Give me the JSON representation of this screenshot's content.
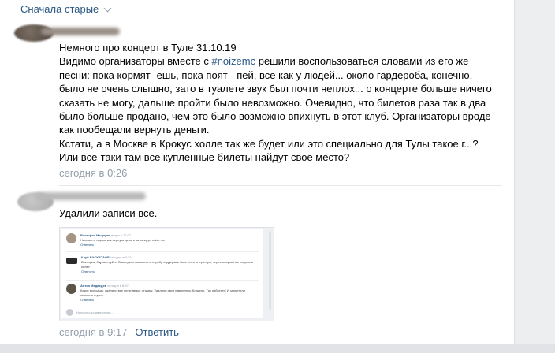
{
  "sort": {
    "label": "Сначала старые"
  },
  "comment1": {
    "lines": [
      "Немного про концерт в Туле 31.10.19",
      "Видимо организаторы вместе с ",
      "#noizemc",
      " решили воспользоваться словами из его же",
      "песни: пока кормят- ешь, пока поят - пей, все как у людей... около гардероба, конечно,",
      "было не очень слышно, зато в туалете звук был почти неплох... о концерте больше ничего",
      "сказать не могу, дальше пройти было невозможно. Очевидно, что билетов раза так в два",
      "было больше продано, чем это было возможно впихнуть в этот клуб. Организаторы вроде",
      "как пообещали вернуть деньги.",
      "Кстати, а в Москве в Крокус холле так же будет или это специально для Тулы такое г...?",
      "Или все-таки там все купленные билеты найдут своё место?"
    ],
    "time": "сегодня в 0:26",
    "reply": "Ответить"
  },
  "comment2": {
    "text": "Удалили записи все.",
    "time": "сегодня в 9:17",
    "reply": "Ответить",
    "screenshot": {
      "c1_name": "Виктория Мещеряк",
      "c1_time": "вчера в 22:07",
      "c1_text": "Напишите людям как вернуть деньги за концерт noize mc",
      "c1_reply": "Ответить",
      "c2_name": "Клуб BACKSTAGE",
      "c2_time": "сегодня в 0:29",
      "c2_text": "Виктория, Здравствуйте. Вам нужно написать в службу поддержки билетного оператора, через который вы покупали билет.",
      "c2_reply": "Ответить",
      "c3_name": "Антон Медведев",
      "c3_time": "сегодня в 8:57",
      "c3_text": "Какие молодцы, удалили все негативные отзывы. Удалили свои извинения. Классно. Так работать! И запретили писать в группу.",
      "c3_reply": "Ответить",
      "input_placeholder": "Написать комментарий..."
    }
  }
}
